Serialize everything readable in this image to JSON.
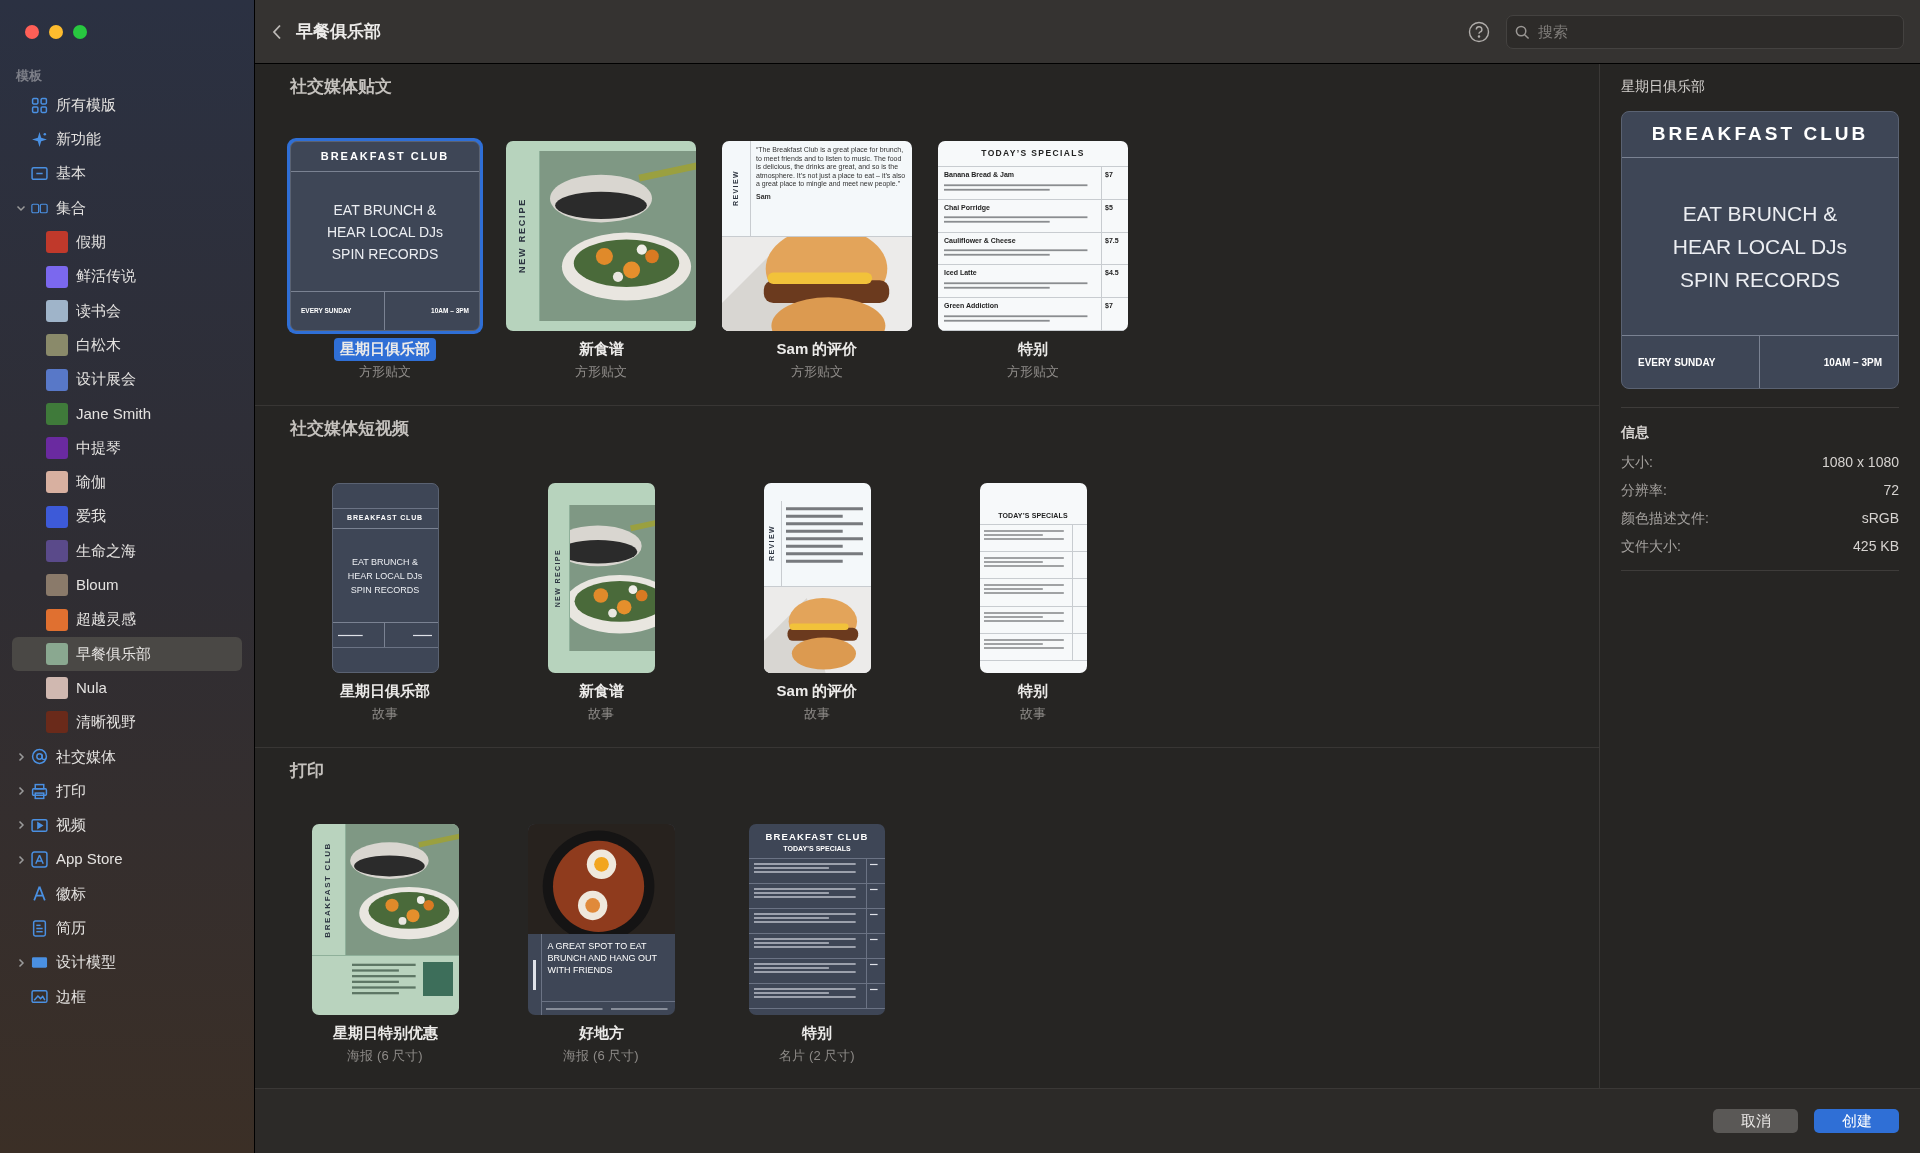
{
  "window": {
    "title": "早餐俱乐部"
  },
  "search": {
    "placeholder": "搜索"
  },
  "sidebar": {
    "section_label": "模板",
    "items": [
      {
        "label": "所有模版",
        "kind": "leaf",
        "selected": false
      },
      {
        "label": "新功能",
        "kind": "leaf",
        "selected": false
      },
      {
        "label": "基本",
        "kind": "leaf",
        "selected": false
      },
      {
        "label": "集合",
        "kind": "group",
        "expanded": true,
        "selected": false,
        "children": [
          {
            "label": "假期",
            "selected": false
          },
          {
            "label": "鲜活传说",
            "selected": false
          },
          {
            "label": "读书会",
            "selected": false
          },
          {
            "label": "白松木",
            "selected": false
          },
          {
            "label": "设计展会",
            "selected": false
          },
          {
            "label": "Jane Smith",
            "selected": false
          },
          {
            "label": "中提琴",
            "selected": false
          },
          {
            "label": "瑜伽",
            "selected": false
          },
          {
            "label": "爱我",
            "selected": false
          },
          {
            "label": "生命之海",
            "selected": false
          },
          {
            "label": "Bloum",
            "selected": false
          },
          {
            "label": "超越灵感",
            "selected": false
          },
          {
            "label": "早餐俱乐部",
            "selected": true
          },
          {
            "label": "Nula",
            "selected": false
          },
          {
            "label": "清晰视野",
            "selected": false
          }
        ]
      },
      {
        "label": "社交媒体",
        "kind": "group",
        "expanded": false,
        "selected": false
      },
      {
        "label": "打印",
        "kind": "group",
        "expanded": false,
        "selected": false
      },
      {
        "label": "视频",
        "kind": "group",
        "expanded": false,
        "selected": false
      },
      {
        "label": "App Store",
        "kind": "group",
        "expanded": false,
        "selected": false
      },
      {
        "label": "徽标",
        "kind": "leaf",
        "selected": false
      },
      {
        "label": "简历",
        "kind": "leaf",
        "selected": false
      },
      {
        "label": "设计模型",
        "kind": "group",
        "expanded": false,
        "selected": false
      },
      {
        "label": "边框",
        "kind": "leaf",
        "selected": false
      }
    ]
  },
  "sections": [
    {
      "title": "社交媒体贴文",
      "cards": [
        {
          "title": "星期日俱乐部",
          "subtitle": "方形贴文",
          "selected": true,
          "preview": {
            "kind": "square_club",
            "heading": "BREAKFAST  CLUB",
            "body": [
              "EAT BRUNCH &",
              "HEAR LOCAL DJs",
              "SPIN RECORDS"
            ],
            "footer_left": "EVERY SUNDAY",
            "footer_right": "10AM – 3PM"
          }
        },
        {
          "title": "新食谱",
          "subtitle": "方形贴文",
          "selected": false,
          "preview": {
            "kind": "square_recipe",
            "side_label": "NEW RECIPE"
          }
        },
        {
          "title": "Sam 的评价",
          "subtitle": "方形贴文",
          "selected": false,
          "preview": {
            "kind": "square_review",
            "side_label": "REVIEW",
            "quote": "“The Breakfast Club is a great place for brunch, to meet friends and to listen to music. The food is delicious, the drinks are great, and so is the atmosphere. It’s not just a place to eat – it’s also a great place to mingle and meet new people.”",
            "author": "Sam"
          }
        },
        {
          "title": "特别",
          "subtitle": "方形贴文",
          "selected": false,
          "preview": {
            "kind": "square_specials",
            "heading": "TODAY’S SPECIALS",
            "items": [
              {
                "name": "Banana Bread & Jam",
                "price": "$7"
              },
              {
                "name": "Chai Porridge",
                "price": "$5"
              },
              {
                "name": "Cauliflower & Cheese",
                "price": "$7.5"
              },
              {
                "name": "Iced Latte",
                "price": "$4.5"
              },
              {
                "name": "Green Addiction",
                "price": "$7"
              }
            ]
          }
        }
      ]
    },
    {
      "title": "社交媒体短视频",
      "cards": [
        {
          "title": "星期日俱乐部",
          "subtitle": "故事",
          "selected": false,
          "preview": {
            "kind": "story_club",
            "heading": "BREAKFAST  CLUB",
            "body": [
              "EAT BRUNCH &",
              "HEAR LOCAL DJs",
              "SPIN RECORDS"
            ]
          }
        },
        {
          "title": "新食谱",
          "subtitle": "故事",
          "selected": false,
          "preview": {
            "kind": "story_recipe",
            "side_label": "NEW RECIPE"
          }
        },
        {
          "title": "Sam 的评价",
          "subtitle": "故事",
          "selected": false,
          "preview": {
            "kind": "story_review",
            "side_label": "REVIEW"
          }
        },
        {
          "title": "特别",
          "subtitle": "故事",
          "selected": false,
          "preview": {
            "kind": "story_specials",
            "heading": "TODAY’S SPECIALS"
          }
        }
      ]
    },
    {
      "title": "打印",
      "cards": [
        {
          "title": "星期日特别优惠",
          "subtitle": "海报 (6 尺寸)",
          "selected": false,
          "preview": {
            "kind": "print_poster",
            "side_label": "BREAKFAST  CLUB"
          }
        },
        {
          "title": "好地方",
          "subtitle": "海报 (6 尺寸)",
          "selected": false,
          "preview": {
            "kind": "print_spot",
            "text": "A GREAT SPOT TO EAT BRUNCH AND HANG OUT WITH FRIENDS"
          }
        },
        {
          "title": "特别",
          "subtitle": "名片 (2 尺寸)",
          "selected": false,
          "preview": {
            "kind": "print_menu",
            "heading": "BREAKFAST  CLUB",
            "subheading": "TODAY’S SPECIALS"
          }
        }
      ]
    }
  ],
  "inspector": {
    "title": "星期日俱乐部",
    "preview": {
      "kind": "large_club",
      "heading": "BREAKFAST  CLUB",
      "body": [
        "EAT BRUNCH &",
        "HEAR LOCAL DJs",
        "SPIN RECORDS"
      ],
      "footer_left": "EVERY SUNDAY",
      "footer_right": "10AM – 3PM"
    },
    "info_heading": "信息",
    "rows": [
      {
        "label": "大小:",
        "value": "1080 x 1080"
      },
      {
        "label": "分辨率:",
        "value": "72"
      },
      {
        "label": "颜色描述文件:",
        "value": "sRGB"
      },
      {
        "label": "文件大小:",
        "value": "425 KB"
      }
    ]
  },
  "buttons": [
    {
      "label": "取消",
      "kind": "secondary"
    },
    {
      "label": "创建",
      "kind": "primary"
    }
  ]
}
